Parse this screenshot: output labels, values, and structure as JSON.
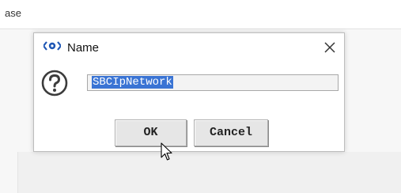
{
  "background": {
    "partial_label": "ase"
  },
  "dialog": {
    "title": "Name",
    "input_value": "SBCIpNetwork",
    "ok_label": "OK",
    "cancel_label": "Cancel",
    "icons": {
      "title": "app-logo-icon",
      "close": "close-icon",
      "prompt": "question-icon",
      "cursor": "mouse-pointer-icon"
    }
  },
  "colors": {
    "selection": "#3a74d4",
    "button_face": "#e6e6e6",
    "logo_blue": "#1f57b5"
  }
}
